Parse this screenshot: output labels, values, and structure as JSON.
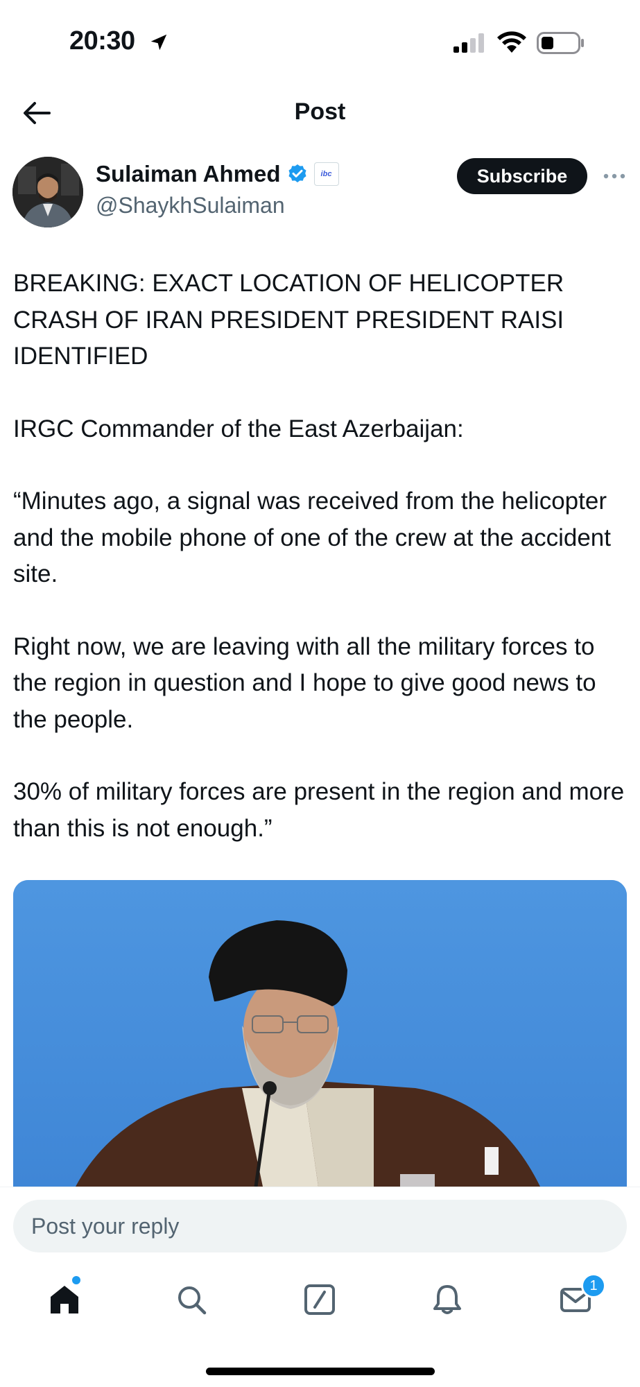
{
  "status_bar": {
    "time": "20:30"
  },
  "header": {
    "title": "Post"
  },
  "author": {
    "name": "Sulaiman Ahmed",
    "handle": "@ShaykhSulaiman",
    "affiliate_badge_text": "ibc",
    "subscribe_label": "Subscribe"
  },
  "post": {
    "paragraphs": [
      "BREAKING: EXACT LOCATION OF HELICOPTER CRASH OF IRAN PRESIDENT PRESIDENT RAISI IDENTIFIED",
      "IRGC Commander of the East Azerbaijan:",
      "“Minutes ago, a signal was received from the helicopter and the mobile phone of one of the crew at the accident site.",
      "Right now, we are leaving with all the military forces to the region in question and I hope to give good news to the people.",
      "30% of military forces are present in the region and more than this is not enough.”"
    ]
  },
  "reply": {
    "placeholder": "Post your reply"
  },
  "nav": {
    "items": [
      "home-icon",
      "search-icon",
      "compose-icon",
      "notifications-icon",
      "messages-icon"
    ],
    "messages_badge": "1"
  },
  "colors": {
    "accent": "#1d9bf0",
    "text": "#0f1419",
    "secondary": "#536471"
  }
}
